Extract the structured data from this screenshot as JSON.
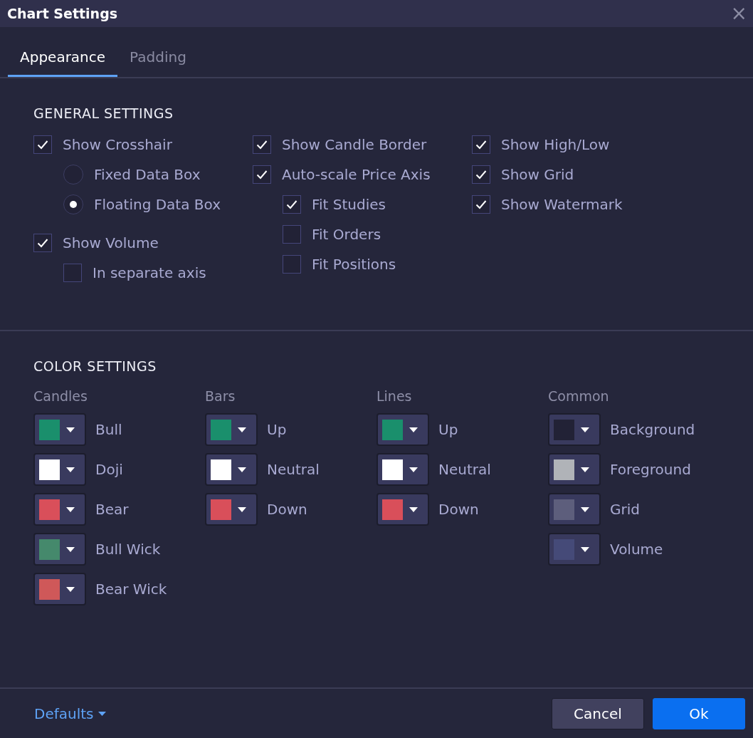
{
  "window": {
    "title": "Chart Settings",
    "close": "×"
  },
  "tabs": [
    {
      "label": "Appearance",
      "selected": true
    },
    {
      "label": "Padding",
      "selected": false
    }
  ],
  "general_settings": {
    "title": "GENERAL SETTINGS",
    "columns": [
      {
        "items": [
          {
            "kind": "checkbox",
            "label": "Show Crosshair",
            "checked": true,
            "children": [
              {
                "kind": "radio",
                "label": "Fixed Data Box",
                "selected": false
              },
              {
                "kind": "radio",
                "label": "Floating Data Box",
                "selected": true
              }
            ]
          },
          {
            "kind": "checkbox",
            "label": "Show Volume",
            "checked": true,
            "children": [
              {
                "kind": "checkbox",
                "label": "In separate axis",
                "checked": false
              }
            ]
          }
        ]
      },
      {
        "items": [
          {
            "kind": "checkbox",
            "label": "Show Candle Border",
            "checked": true
          },
          {
            "kind": "checkbox",
            "label": "Auto-scale Price Axis",
            "checked": true,
            "children": [
              {
                "kind": "checkbox",
                "label": "Fit Studies",
                "checked": true
              },
              {
                "kind": "checkbox",
                "label": "Fit Orders",
                "checked": false
              },
              {
                "kind": "checkbox",
                "label": "Fit Positions",
                "checked": false
              }
            ]
          }
        ]
      },
      {
        "items": [
          {
            "kind": "checkbox",
            "label": "Show High/Low",
            "checked": true
          },
          {
            "kind": "checkbox",
            "label": "Show Grid",
            "checked": true
          },
          {
            "kind": "checkbox",
            "label": "Show Watermark",
            "checked": true
          }
        ]
      }
    ]
  },
  "color_settings": {
    "title": "COLOR SETTINGS",
    "groups": [
      {
        "title": "Candles",
        "items": [
          {
            "label": "Bull",
            "color": "#1a8f6c"
          },
          {
            "label": "Doji",
            "color": "#ffffff"
          },
          {
            "label": "Bear",
            "color": "#d94f5a"
          },
          {
            "label": "Bull Wick",
            "color": "#45896c"
          },
          {
            "label": "Bear Wick",
            "color": "#cf5859"
          }
        ]
      },
      {
        "title": "Bars",
        "items": [
          {
            "label": "Up",
            "color": "#1a8f6c"
          },
          {
            "label": "Neutral",
            "color": "#ffffff"
          },
          {
            "label": "Down",
            "color": "#d94f5a"
          }
        ]
      },
      {
        "title": "Lines",
        "items": [
          {
            "label": "Up",
            "color": "#1a8f6c"
          },
          {
            "label": "Neutral",
            "color": "#ffffff"
          },
          {
            "label": "Down",
            "color": "#d94f5a"
          }
        ]
      },
      {
        "title": "Common",
        "items": [
          {
            "label": "Background",
            "color": "#222236"
          },
          {
            "label": "Foreground",
            "color": "#b0b3b8"
          },
          {
            "label": "Grid",
            "color": "#5d5e7c"
          },
          {
            "label": "Volume",
            "color": "#454a78"
          }
        ]
      }
    ]
  },
  "footer": {
    "defaults": "Defaults",
    "buttons": [
      {
        "label": "Cancel",
        "kind": "secondary"
      },
      {
        "label": "Ok",
        "kind": "primary"
      }
    ]
  }
}
